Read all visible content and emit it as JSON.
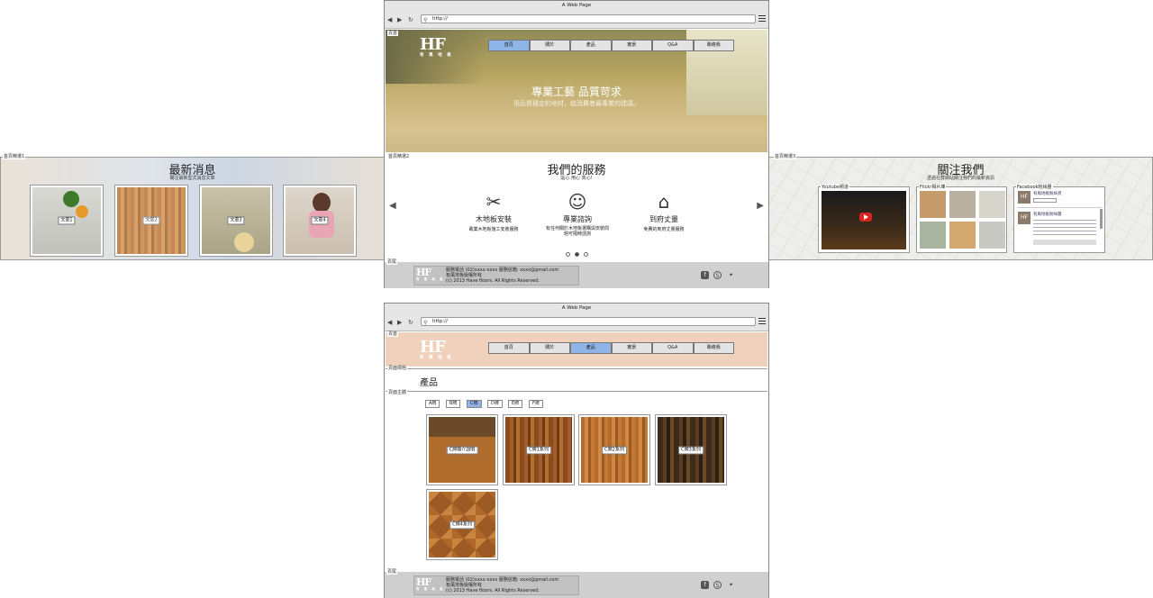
{
  "browser": {
    "title": "A Web Page",
    "url": "http://"
  },
  "home": {
    "header_label": "頁首",
    "logo_main": "HF",
    "logo_sub": "有 風 地 板",
    "nav": [
      "首頁",
      "關於",
      "產品",
      "實景",
      "Q&A",
      "聯絡我"
    ],
    "hero_title": "專業工藝 品質苛求",
    "hero_sub": "用品質穩定的地材，給消費者最專業的建議。",
    "feature1": {
      "label": "首頁精選1",
      "title": "最新消息",
      "sub": "關注最新型式消息文章",
      "articles": [
        "文章1",
        "文章2",
        "文章3",
        "文章4"
      ]
    },
    "feature2": {
      "label": "首頁精選2",
      "title": "我們的服務",
      "sub": "貼心 用心 真心!",
      "services": [
        {
          "icon": "tools-icon",
          "title": "木地板安裝",
          "desc": "專業木地板施工安裝服務"
        },
        {
          "icon": "headset-icon",
          "title": "專業諮詢",
          "desc": "有任何關於木地板選購與安裝問題可隨時諮詢"
        },
        {
          "icon": "house-icon",
          "title": "到府丈量",
          "desc": "免費的到府丈量服務"
        }
      ]
    },
    "feature3": {
      "label": "首頁精選3",
      "title": "關注我們",
      "sub": "透過社群網站關注我們的最新資訊",
      "youtube": "Youtube頻道",
      "flickr": "Flickr相片庫",
      "facebook": "Facebook粉絲團",
      "fb_page": "有風地板粉絲頁",
      "fb_post": "有風地板粉絲團"
    },
    "footer": {
      "label": "頁尾"
    }
  },
  "footer": {
    "line1": "服務電話 (02)xxxx-xxxx 服務信箱: xxxx@gmail.com",
    "line2": "有風地板版權所有",
    "line3": "(c) 2013 Have floors. All Rights Reserved."
  },
  "products": {
    "header_label": "頁首",
    "title_label": "頁面標題",
    "page_title": "產品",
    "body_label": "頁面主體",
    "footer_label": "頁尾",
    "filters": [
      "A牌",
      "B牌",
      "C牌",
      "D牌",
      "E牌",
      "F牌"
    ],
    "selected_filter": "C牌",
    "items": [
      "C牌簡介說明",
      "C牌1系列",
      "C牌2系列",
      "C牌3系列",
      "C牌4系列"
    ]
  },
  "colors": {
    "active_nav": "#8fb4e8",
    "header_peach": "#f0d2bc",
    "footer_gray": "#cfcfcf"
  }
}
